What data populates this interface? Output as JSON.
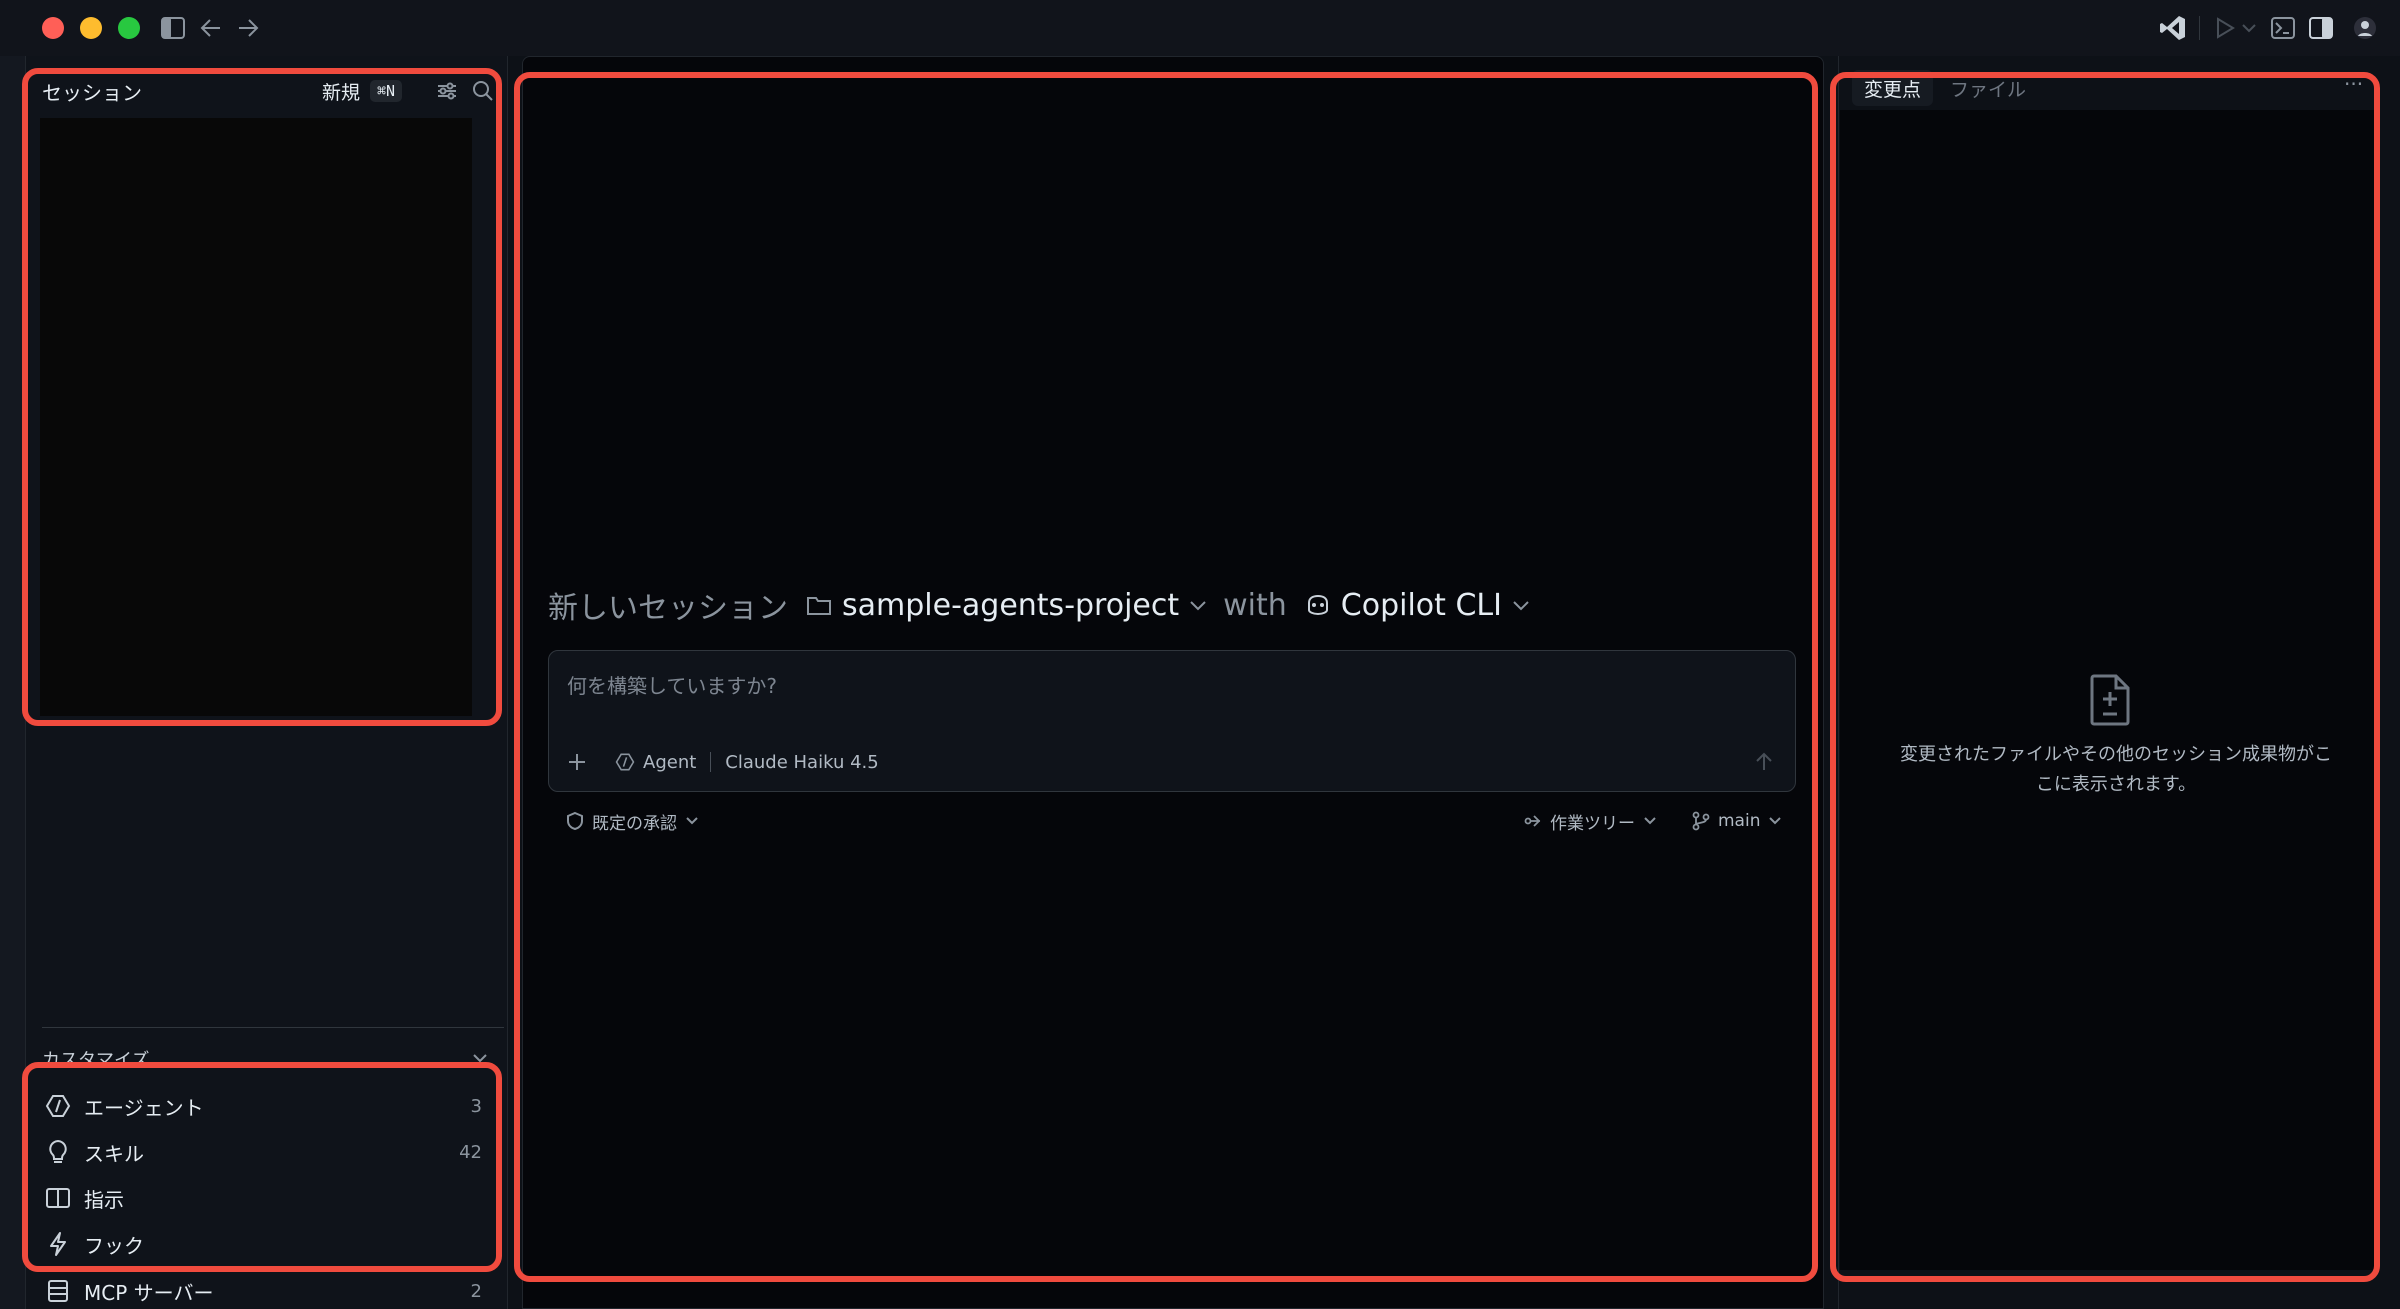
{
  "sessions_panel": {
    "title": "セッション",
    "new_label": "新規",
    "new_shortcut": "⌘N"
  },
  "customize": {
    "title": "カスタマイズ",
    "items": [
      {
        "label": "エージェント",
        "count": "3",
        "icon": "agent-icon"
      },
      {
        "label": "スキル",
        "count": "42",
        "icon": "lightbulb-icon"
      },
      {
        "label": "指示",
        "count": "",
        "icon": "book-icon"
      },
      {
        "label": "フック",
        "count": "",
        "icon": "lightning-icon"
      },
      {
        "label": "MCP サーバー",
        "count": "2",
        "icon": "server-icon"
      }
    ]
  },
  "new_session": {
    "title": "新しいセッション",
    "project": "sample-agents-project",
    "with_word": "with",
    "agent_cli": "Copilot CLI",
    "input_placeholder": "何を構築していますか?",
    "mode": "Agent",
    "model": "Claude Haiku 4.5",
    "approval": "既定の承認",
    "worktree": "作業ツリー",
    "branch": "main"
  },
  "changes_panel": {
    "tabs": [
      "変更点",
      "ファイル"
    ],
    "more": "···",
    "empty_text": "変更されたファイルやその他のセッション成果物がここに表示されます。"
  },
  "colors": {
    "highlight": "#f04b3e",
    "background": "#0d1117"
  }
}
